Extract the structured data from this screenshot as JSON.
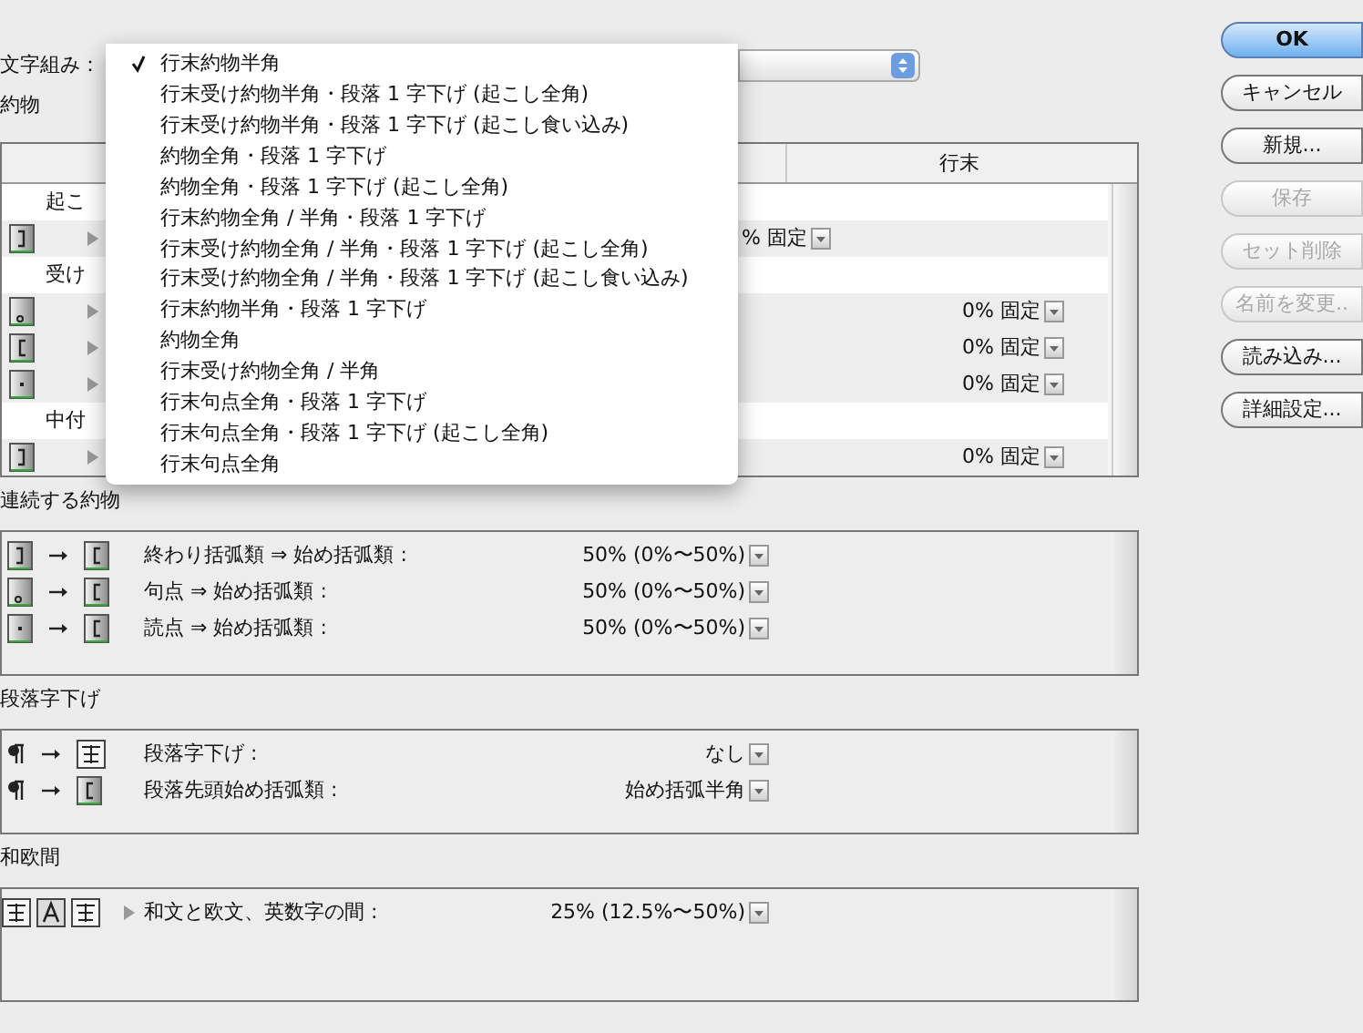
{
  "composition": {
    "label": "文字組み：",
    "menu": [
      {
        "label": "行末約物半角",
        "selected": true
      },
      {
        "label": "行末受け約物半角・段落 1 字下げ (起こし全角)",
        "selected": false
      },
      {
        "label": "行末受け約物半角・段落 1 字下げ (起こし食い込み)",
        "selected": false
      },
      {
        "label": "約物全角・段落 1 字下げ",
        "selected": false
      },
      {
        "label": "約物全角・段落 1 字下げ (起こし全角)",
        "selected": false
      },
      {
        "label": "行末約物全角 / 半角・段落 1 字下げ",
        "selected": false
      },
      {
        "label": "行末受け約物全角 / 半角・段落 1 字下げ (起こし全角)",
        "selected": false
      },
      {
        "label": "行末受け約物全角 / 半角・段落 1 字下げ (起こし食い込み)",
        "selected": false
      },
      {
        "label": "行末約物半角・段落 1 字下げ",
        "selected": false
      },
      {
        "label": "約物全角",
        "selected": false
      },
      {
        "label": "行末受け約物全角 / 半角",
        "selected": false
      },
      {
        "label": "行末句点全角・段落 1 字下げ",
        "selected": false
      },
      {
        "label": "行末句点全角・段落 1 字下げ (起こし全角)",
        "selected": false
      },
      {
        "label": "行末句点全角",
        "selected": false
      }
    ]
  },
  "punctuation": {
    "title": "約物",
    "columns": [
      {
        "label": "行末"
      }
    ],
    "groups": [
      {
        "label": "起こ",
        "rows": [
          {
            "kind": "middle",
            "value": "% 固定"
          }
        ]
      },
      {
        "label": "受け",
        "rows": [
          {
            "kind": "end",
            "value": "0% 固定"
          },
          {
            "kind": "end",
            "value": "0% 固定"
          },
          {
            "kind": "end",
            "value": "0% 固定"
          }
        ]
      },
      {
        "label": "中付",
        "rows": [
          {
            "kind": "end",
            "value": "0% 固定"
          }
        ]
      }
    ]
  },
  "sections": [
    {
      "title": "連続する約物",
      "kind": "pair",
      "rows": [
        {
          "label": "終わり括弧類 ⇒ 始め括弧類 :",
          "value": "50% (0%〜50%)"
        },
        {
          "label": "句点 ⇒ 始め括弧類 :",
          "value": "50% (0%〜50%)"
        },
        {
          "label": "読点 ⇒ 始め括弧類 :",
          "value": "50% (0%〜50%)"
        }
      ]
    },
    {
      "title": "段落字下げ",
      "kind": "paragraph",
      "rows": [
        {
          "label": "段落字下げ :",
          "value": "なし"
        },
        {
          "label": "段落先頭始め括弧類 :",
          "value": "始め括弧半角"
        }
      ]
    },
    {
      "title": "和欧間",
      "kind": "spacing",
      "rows": [
        {
          "label": "和文と欧文、英数字の間 :",
          "value": "25% (12.5%〜50%)"
        }
      ]
    }
  ],
  "buttons": [
    {
      "label": "OK",
      "kind": "default",
      "disabled": false
    },
    {
      "label": "キャンセル",
      "kind": "normal",
      "disabled": false
    },
    {
      "label": "新規...",
      "kind": "normal",
      "disabled": false
    },
    {
      "label": "保存",
      "kind": "normal",
      "disabled": true
    },
    {
      "label": "セット削除",
      "kind": "normal",
      "disabled": true
    },
    {
      "label": "名前を変更..",
      "kind": "normal",
      "disabled": true
    },
    {
      "label": "読み込み...",
      "kind": "normal",
      "disabled": false
    },
    {
      "label": "詳細設定...",
      "kind": "normal",
      "disabled": false
    }
  ]
}
